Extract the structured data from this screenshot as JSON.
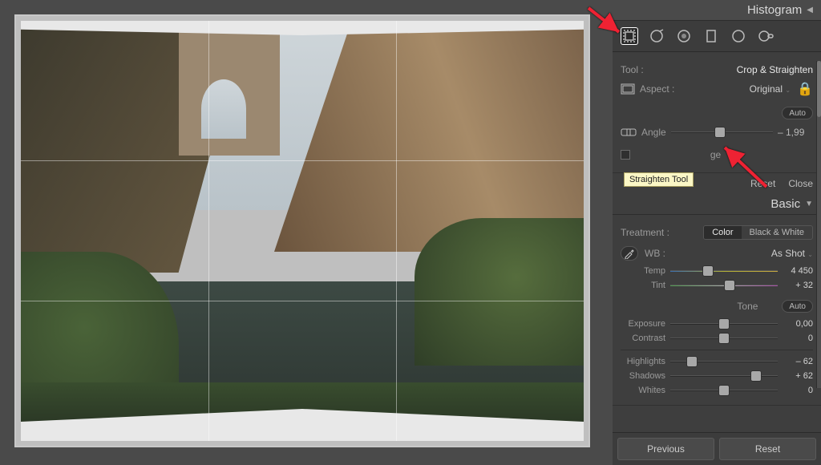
{
  "panel": {
    "histogram_title": "Histogram",
    "tool_label": "Tool :",
    "tool_name": "Crop & Straighten",
    "aspect_label": "Aspect :",
    "aspect_value": "Original",
    "auto_label": "Auto",
    "angle_label": "Angle",
    "angle_value": "– 1,99",
    "image_checkbox_suffix": "ge",
    "reset": "Reset",
    "close": "Close"
  },
  "tooltip": {
    "straighten": "Straighten Tool"
  },
  "basic": {
    "title": "Basic",
    "treatment_label": "Treatment :",
    "treatment_color": "Color",
    "treatment_bw": "Black & White",
    "wb_label": "WB :",
    "wb_value": "As Shot",
    "temp_label": "Temp",
    "temp_value": "4 450",
    "tint_label": "Tint",
    "tint_value": "+ 32",
    "tone_label": "Tone",
    "tone_auto": "Auto",
    "exposure_label": "Exposure",
    "exposure_value": "0,00",
    "contrast_label": "Contrast",
    "contrast_value": "0",
    "highlights_label": "Highlights",
    "highlights_value": "– 62",
    "shadows_label": "Shadows",
    "shadows_value": "+ 62",
    "whites_label": "Whites",
    "whites_value": "0"
  },
  "buttons": {
    "previous": "Previous",
    "reset": "Reset"
  },
  "slider_positions": {
    "angle": 48,
    "temp": 35,
    "tint": 55,
    "exposure": 50,
    "contrast": 50,
    "highlights": 20,
    "shadows": 80,
    "whites": 50
  }
}
